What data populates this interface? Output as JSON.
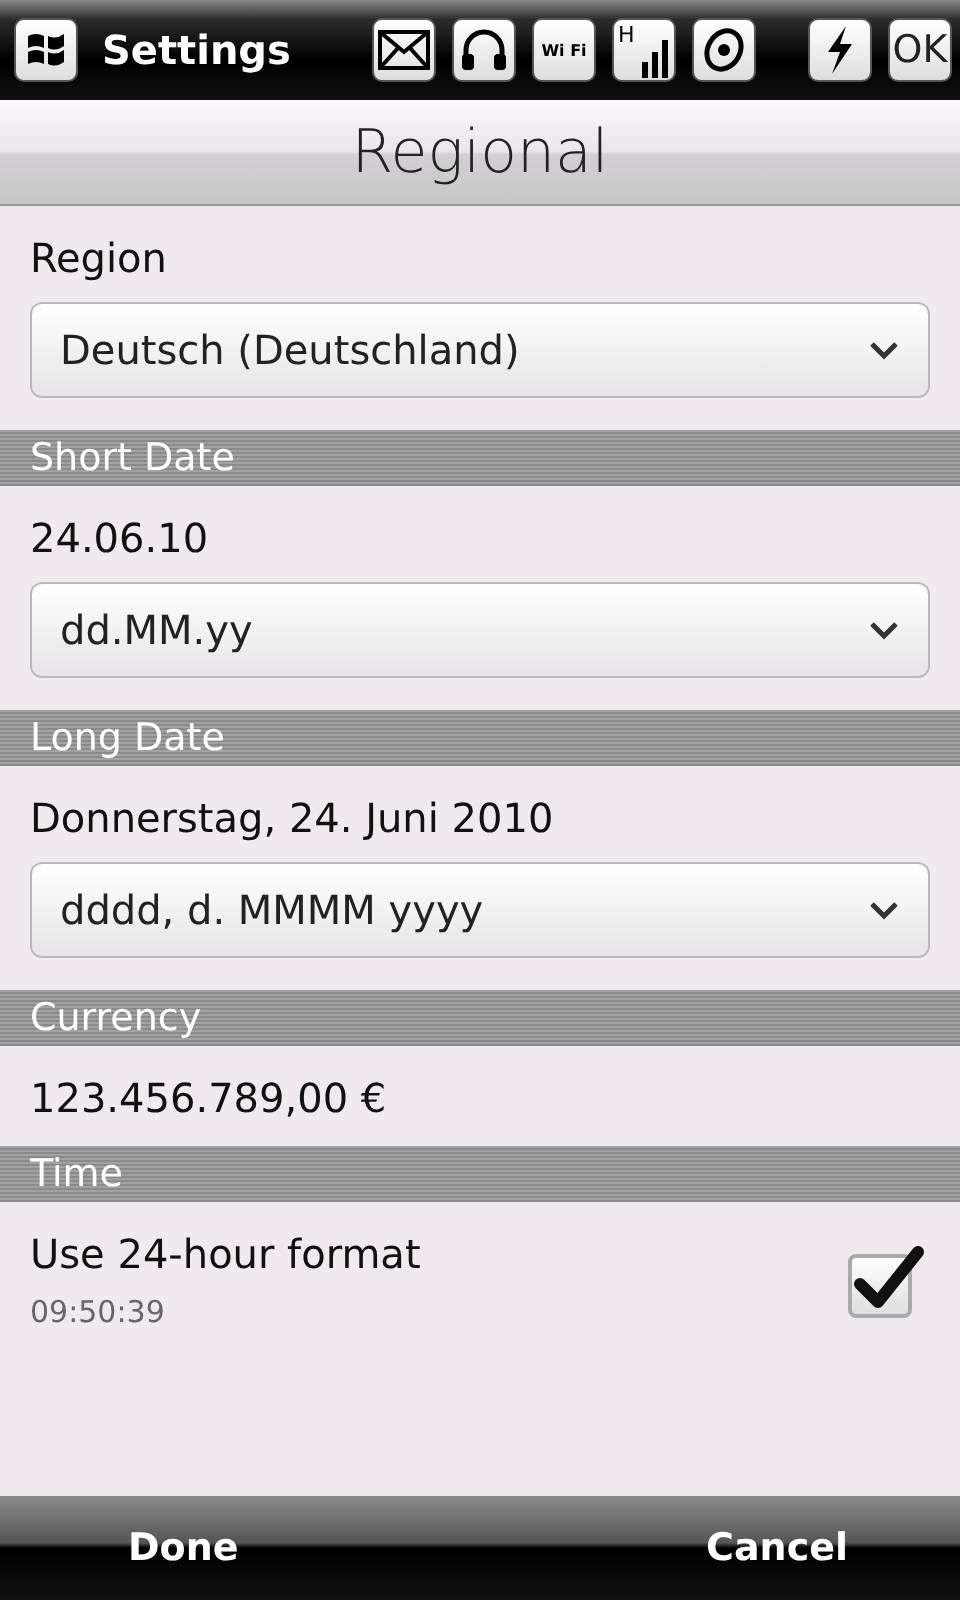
{
  "top_bar": {
    "title": "Settings",
    "status_icons": [
      {
        "kind": "mail"
      },
      {
        "kind": "headphones"
      },
      {
        "kind": "wifi",
        "label": "Wi Fi"
      },
      {
        "kind": "signal",
        "label": "H"
      },
      {
        "kind": "speaker"
      }
    ],
    "power_icon": {
      "kind": "power"
    },
    "ok_button": "OK"
  },
  "page_title": "Regional",
  "items": [
    {
      "kind": "label",
      "text": "Region"
    },
    {
      "kind": "dropdown",
      "value": "Deutsch (Deutschland)"
    },
    {
      "kind": "header",
      "text": "Short Date"
    },
    {
      "kind": "value",
      "text": "24.06.10"
    },
    {
      "kind": "dropdown",
      "value": "dd.MM.yy"
    },
    {
      "kind": "header",
      "text": "Long Date"
    },
    {
      "kind": "value",
      "text": "Donnerstag, 24. Juni 2010"
    },
    {
      "kind": "dropdown",
      "value": "dddd, d. MMMM yyyy"
    },
    {
      "kind": "header",
      "text": "Currency"
    },
    {
      "kind": "value",
      "text": "123.456.789,00 €"
    },
    {
      "kind": "header",
      "text": "Time"
    },
    {
      "kind": "checkbox",
      "text": "Use 24-hour format",
      "detail": "09:50:39",
      "checked": true
    }
  ],
  "bottom_bar": {
    "left": "Done",
    "right": "Cancel"
  }
}
